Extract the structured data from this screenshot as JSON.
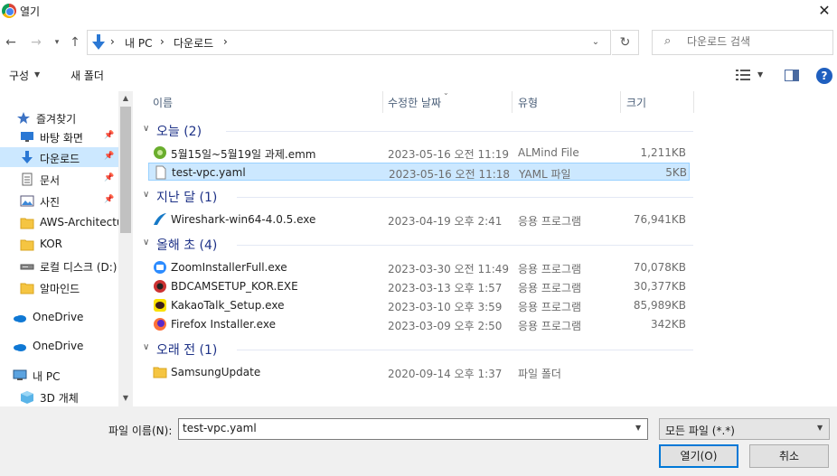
{
  "window": {
    "title": "열기"
  },
  "nav": {
    "breadcrumb": [
      "내 PC",
      "다운로드"
    ],
    "search_placeholder": "다운로드 검색"
  },
  "toolbar": {
    "organize": "구성",
    "new_folder": "새 폴더"
  },
  "sidebar": {
    "items": [
      {
        "label": "즐겨찾기",
        "icon": "star-icon"
      },
      {
        "label": "바탕 화면",
        "icon": "desktop-icon",
        "pinned": true
      },
      {
        "label": "다운로드",
        "icon": "download-arrow-icon",
        "pinned": true,
        "selected": true
      },
      {
        "label": "문서",
        "icon": "document-icon",
        "pinned": true
      },
      {
        "label": "사진",
        "icon": "picture-icon",
        "pinned": true
      },
      {
        "label": "AWS-Architectu",
        "icon": "folder-icon"
      },
      {
        "label": "KOR",
        "icon": "folder-icon"
      },
      {
        "label": "로컬 디스크 (D:)",
        "icon": "drive-icon"
      },
      {
        "label": "알마인드",
        "icon": "folder-icon"
      },
      {
        "label": "OneDrive",
        "icon": "cloud-icon"
      },
      {
        "label": "OneDrive",
        "icon": "cloud-icon"
      },
      {
        "label": "내 PC",
        "icon": "computer-icon"
      },
      {
        "label": "3D 개체",
        "icon": "cube-icon"
      }
    ]
  },
  "columns": {
    "name": "이름",
    "modified": "수정한 날짜",
    "type": "유형",
    "size": "크기"
  },
  "groups": [
    {
      "label": "오늘 (2)",
      "files": [
        {
          "name": "5월15일~5월19일 과제.emm",
          "date": "2023-05-16 오전 11:19",
          "type": "ALMind File",
          "size": "1,211KB",
          "icon": "almind-icon"
        },
        {
          "name": "test-vpc.yaml",
          "date": "2023-05-16 오전 11:18",
          "type": "YAML 파일",
          "size": "5KB",
          "icon": "blank-file-icon",
          "selected": true
        }
      ]
    },
    {
      "label": "지난 달 (1)",
      "files": [
        {
          "name": "Wireshark-win64-4.0.5.exe",
          "date": "2023-04-19 오후 2:41",
          "type": "응용 프로그램",
          "size": "76,941KB",
          "icon": "wireshark-icon"
        }
      ]
    },
    {
      "label": "올해 초 (4)",
      "files": [
        {
          "name": "ZoomInstallerFull.exe",
          "date": "2023-03-30 오전 11:49",
          "type": "응용 프로그램",
          "size": "70,078KB",
          "icon": "zoom-icon"
        },
        {
          "name": "BDCAMSETUP_KOR.EXE",
          "date": "2023-03-13 오후 1:57",
          "type": "응용 프로그램",
          "size": "30,377KB",
          "icon": "bandicam-icon"
        },
        {
          "name": "KakaoTalk_Setup.exe",
          "date": "2023-03-10 오후 3:59",
          "type": "응용 프로그램",
          "size": "85,989KB",
          "icon": "kakaotalk-icon"
        },
        {
          "name": "Firefox Installer.exe",
          "date": "2023-03-09 오후 2:50",
          "type": "응용 프로그램",
          "size": "342KB",
          "icon": "firefox-icon"
        }
      ]
    },
    {
      "label": "오래 전 (1)",
      "files": [
        {
          "name": "SamsungUpdate",
          "date": "2020-09-14 오후 1:37",
          "type": "파일 폴더",
          "size": "",
          "icon": "folder-icon"
        }
      ]
    }
  ],
  "footer": {
    "filename_label": "파일 이름(N):",
    "filename_value": "test-vpc.yaml",
    "filter": "모든 파일 (*.*)",
    "open": "열기(O)",
    "cancel": "취소"
  },
  "colors": {
    "selection": "#cce8ff",
    "group_header": "#1e3287",
    "accent": "#0078d7"
  }
}
